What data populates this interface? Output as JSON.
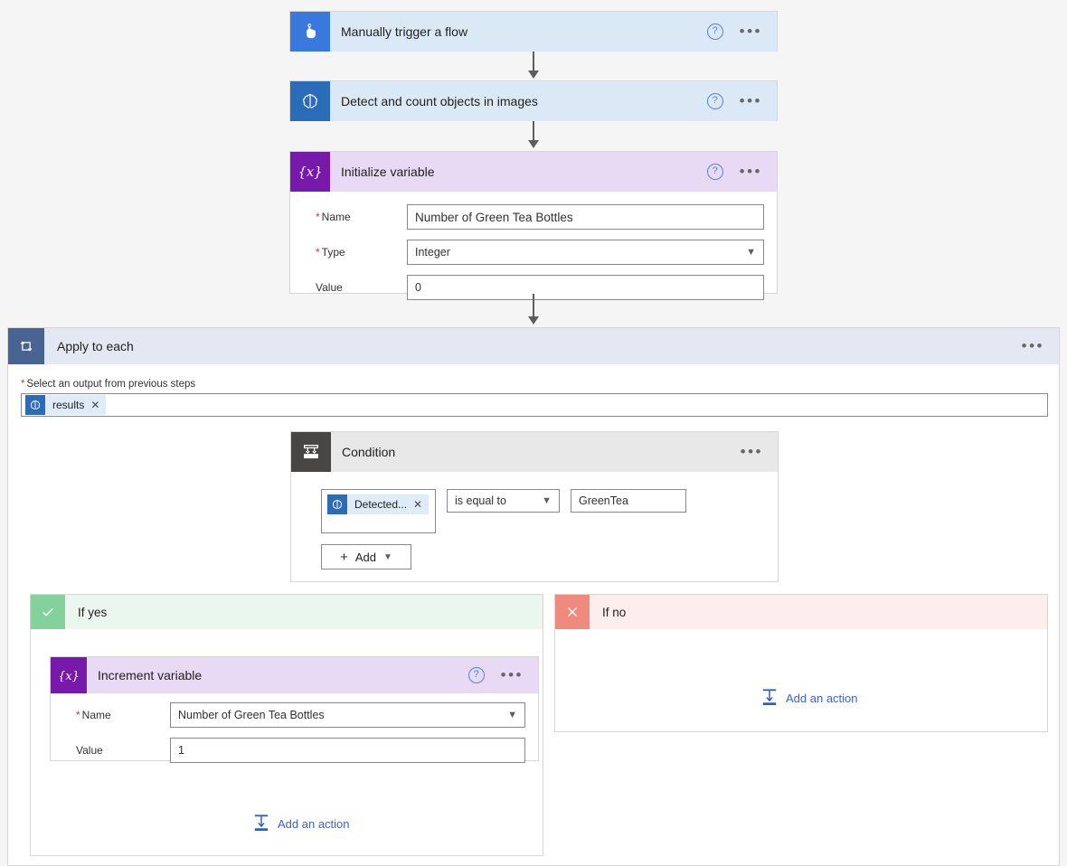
{
  "flow": {
    "steps": [
      {
        "id": "trigger",
        "title": "Manually trigger a flow",
        "icon": "tap-hand-icon",
        "help": "?",
        "menu": "•••"
      },
      {
        "id": "detect",
        "title": "Detect and count objects in images",
        "icon": "ai-brain-icon",
        "help": "?",
        "menu": "•••"
      },
      {
        "id": "init_variable",
        "title": "Initialize variable",
        "icon": "variable-braces-icon",
        "help": "?",
        "menu": "•••",
        "fields": [
          {
            "label": "Name",
            "required": true,
            "value": "Number of Green Tea Bottles",
            "control": "text"
          },
          {
            "label": "Type",
            "required": true,
            "value": "Integer",
            "control": "dropdown"
          },
          {
            "label": "Value",
            "required": false,
            "value": "0",
            "control": "text"
          }
        ]
      }
    ],
    "apply_to_each": {
      "title": "Apply to each",
      "icon": "loop-icon",
      "menu": "•••",
      "output_label": "Select an output from previous steps",
      "output_required": true,
      "token": {
        "label": "results",
        "icon": "ai-brain-icon",
        "remove": "✕"
      },
      "condition": {
        "title": "Condition",
        "icon": "condition-branch-icon",
        "menu": "•••",
        "left_token": {
          "label": "Detected...",
          "icon": "ai-brain-icon",
          "remove": "✕"
        },
        "operator": "is equal to",
        "right_value": "GreenTea",
        "add_button": "Add"
      },
      "if_yes": {
        "title": "If yes",
        "icon": "check-icon",
        "action": {
          "title": "Increment variable",
          "icon": "variable-braces-icon",
          "help": "?",
          "menu": "•••",
          "fields": [
            {
              "label": "Name",
              "required": true,
              "value": "Number of Green Tea Bottles",
              "control": "dropdown"
            },
            {
              "label": "Value",
              "required": false,
              "value": "1",
              "control": "text"
            }
          ]
        },
        "add_action": {
          "label": "Add an action",
          "icon": "add-action-icon"
        }
      },
      "if_no": {
        "title": "If no",
        "icon": "close-icon",
        "add_action": {
          "label": "Add an action",
          "icon": "add-action-icon"
        }
      }
    }
  },
  "colors": {
    "background": "#f5f5f5",
    "trigger_header": "#dbe9f7",
    "variable_header": "#e8daf5",
    "condition_header": "#e8e8e8",
    "loop_header": "#e3e8f2",
    "yes_header": "#eaf7ee",
    "no_header": "#fceeec",
    "variable_accent": "#7719aa",
    "trigger_accent": "#3b78de",
    "ai_accent": "#2b6cb8",
    "link": "#3a62d1",
    "required": "#d13438"
  }
}
